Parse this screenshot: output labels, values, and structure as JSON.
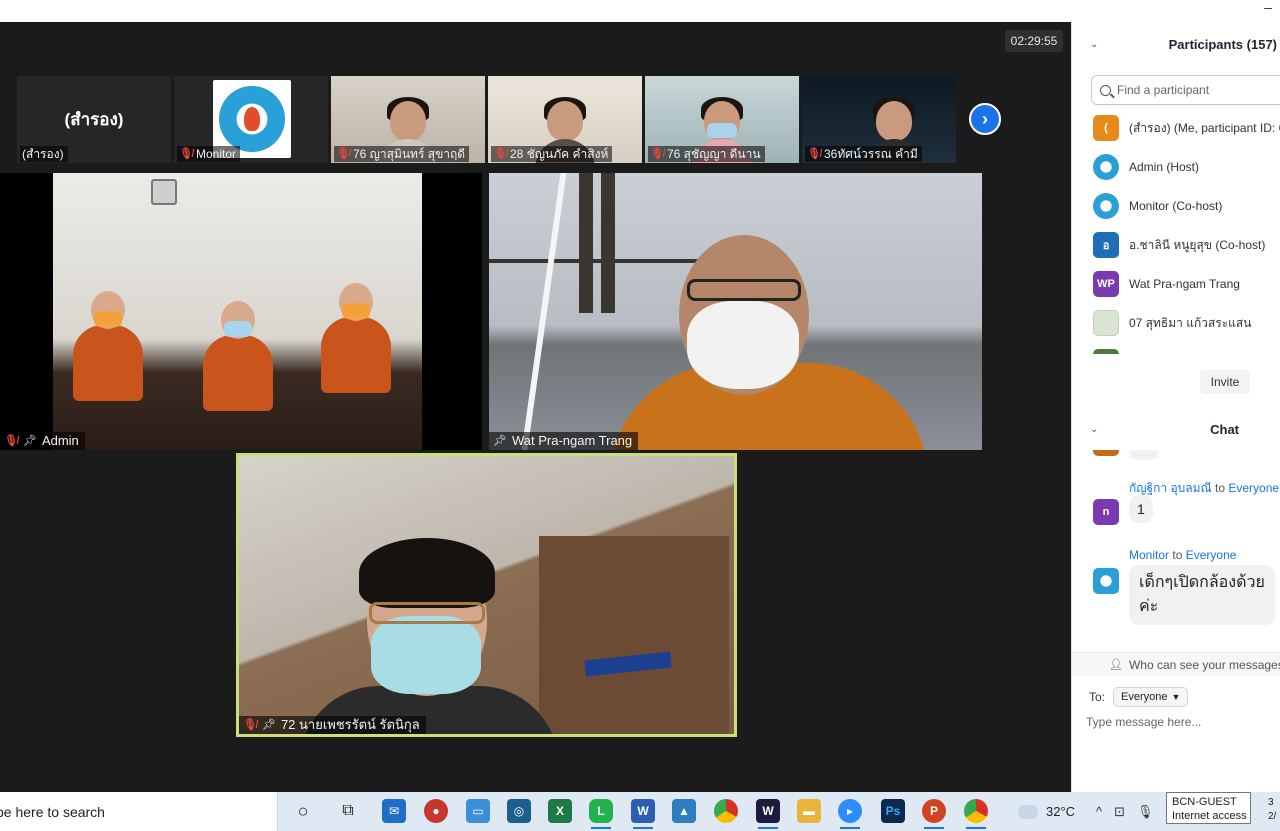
{
  "window": {
    "minimize_glyph": "–"
  },
  "meeting": {
    "timer": "02:29:55",
    "strip": [
      {
        "name": "(สำรอง)",
        "big_label": "(สำรอง)",
        "muted": false
      },
      {
        "name": "Monitor",
        "muted": true
      },
      {
        "name": "76 ญาสุมินทร์ สุขาฤดี",
        "muted": true
      },
      {
        "name": "28 ชัญนภัค คำสิงห์",
        "muted": true
      },
      {
        "name": "76 สุชัญญา ดีนาน",
        "muted": true
      },
      {
        "name": "36ทัศน์วรรณ คำมี",
        "muted": true
      }
    ],
    "tiles": {
      "admin": {
        "name": "Admin"
      },
      "wat": {
        "name": "Wat Pra-ngam Trang"
      },
      "speaker": {
        "name": "72 นายเพชรรัตน์ รัตนิกุล"
      }
    }
  },
  "panel": {
    "participants_title": "Participants (157)",
    "search_placeholder": "Find a participant",
    "participants": [
      {
        "initial": "(",
        "color": "#e88a1a",
        "name": "(สำรอง) (Me, participant ID: 6"
      },
      {
        "initial": "",
        "color": "#2aa0d8",
        "name": "Admin (Host)"
      },
      {
        "initial": "",
        "color": "#2aa0d8",
        "name": "Monitor (Co-host)"
      },
      {
        "initial": "อ",
        "color": "#1f6fb7",
        "name": "อ.ชาลินี หนูยุสุข (Co-host)"
      },
      {
        "initial": "WP",
        "color": "#7b3bb0",
        "name": "Wat Pra-ngam Trang"
      },
      {
        "initial": "",
        "color": "#d9e4d2",
        "name": "07 สุทธิมา แก้วสระแสน"
      }
    ],
    "invite_label": "Invite",
    "chat_title": "Chat",
    "messages": [
      {
        "sender": "กัญฐิกา อุบลมณี",
        "to_word": "to",
        "recipient": "Everyone",
        "initial": "n",
        "color": "#7b3bb0",
        "text": "1"
      },
      {
        "sender": "Monitor",
        "to_word": "to",
        "recipient": "Everyone",
        "initial": "",
        "color": "#2aa0d8",
        "text_line1": "เด็กๆเปิดกล้องด้วย",
        "text_line2": "ค่ะ"
      }
    ],
    "who_can_see": "Who can see your messages? R",
    "to_label": "To:",
    "to_value": "Everyone",
    "message_placeholder": "Type message here..."
  },
  "taskbar": {
    "search_text": "pe here to search",
    "temperature": "32°C",
    "tooltip_line1": "BCN-GUEST",
    "tooltip_line2": "Internet access",
    "clock_line1": "3",
    "clock_line2": "2/"
  }
}
